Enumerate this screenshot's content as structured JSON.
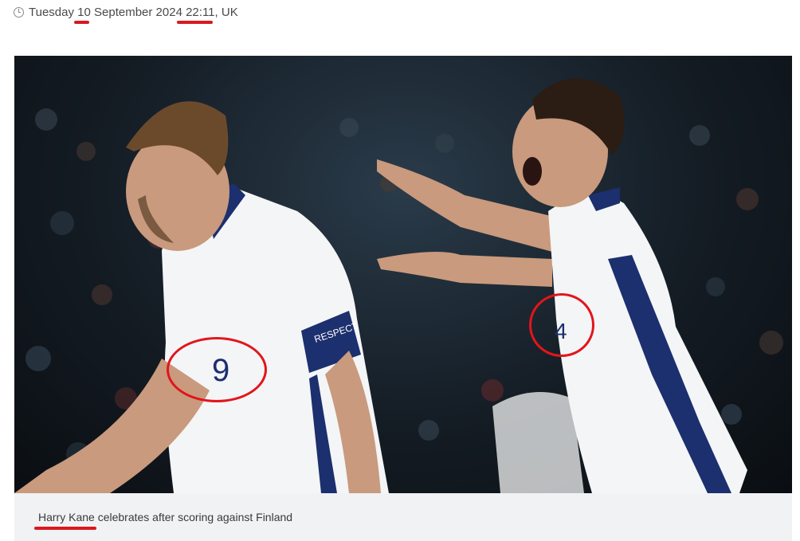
{
  "dateline": {
    "icon": "clock-icon",
    "day_name": "Tuesday ",
    "day": "10",
    "month_year": " September 2024 ",
    "time": "22:11",
    "region": ", UK"
  },
  "hero_image": {
    "jersey_numbers": [
      "9",
      "4"
    ],
    "sleeve_text": "RESPECT",
    "annotation_color": "#e2151b"
  },
  "caption": {
    "text": "Harry Kane celebrates after scoring against Finland"
  },
  "colors": {
    "highlight_red": "#d8191f",
    "kit_navy": "#1c2f6e",
    "caption_bg": "#f1f2f4"
  }
}
